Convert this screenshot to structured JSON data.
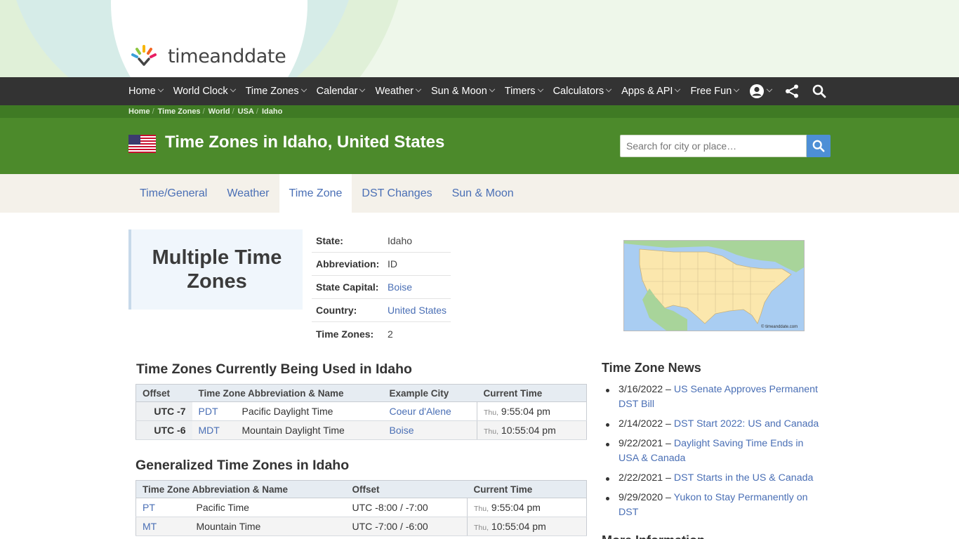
{
  "brand": {
    "name": "timeanddate"
  },
  "nav": {
    "items": [
      "Home",
      "World Clock",
      "Time Zones",
      "Calendar",
      "Weather",
      "Sun & Moon",
      "Timers",
      "Calculators",
      "Apps & API",
      "Free Fun"
    ]
  },
  "breadcrumb": [
    "Home",
    "Time Zones",
    "World",
    "USA",
    "Idaho"
  ],
  "header": {
    "title": "Time Zones in Idaho, United States",
    "search_placeholder": "Search for city or place…"
  },
  "tabs": [
    {
      "label": "Time/General",
      "active": false
    },
    {
      "label": "Weather",
      "active": false
    },
    {
      "label": "Time Zone",
      "active": true
    },
    {
      "label": "DST Changes",
      "active": false
    },
    {
      "label": "Sun & Moon",
      "active": false
    }
  ],
  "summary": {
    "headline": "Multiple Time Zones",
    "facts": [
      {
        "key": "State:",
        "value": "Idaho",
        "link": false
      },
      {
        "key": "Abbreviation:",
        "value": "ID",
        "link": false
      },
      {
        "key": "State Capital:",
        "value": "Boise",
        "link": true
      },
      {
        "key": "Country:",
        "value": "United States",
        "link": true
      },
      {
        "key": "Time Zones:",
        "value": "2",
        "link": false
      }
    ]
  },
  "map": {
    "credit": "© timeanddate.com"
  },
  "current_zones": {
    "title": "Time Zones Currently Being Used in Idaho",
    "headers": [
      "Offset",
      "Time Zone Abbreviation & Name",
      "Example City",
      "Current Time"
    ],
    "rows": [
      {
        "offset": "UTC -7",
        "abbr": "PDT",
        "name": "Pacific Daylight Time",
        "city": "Coeur d'Alene",
        "day": "Thu,",
        "time": "9:55:04 pm"
      },
      {
        "offset": "UTC -6",
        "abbr": "MDT",
        "name": "Mountain Daylight Time",
        "city": "Boise",
        "day": "Thu,",
        "time": "10:55:04 pm"
      }
    ]
  },
  "general_zones": {
    "title": "Generalized Time Zones in Idaho",
    "headers": [
      "Time Zone Abbreviation & Name",
      "Offset",
      "Current Time"
    ],
    "rows": [
      {
        "abbr": "PT",
        "name": "Pacific Time",
        "offset": "UTC -8:00 / -7:00",
        "day": "Thu,",
        "time": "9:55:04 pm"
      },
      {
        "abbr": "MT",
        "name": "Mountain Time",
        "offset": "UTC -7:00 / -6:00",
        "day": "Thu,",
        "time": "10:55:04 pm"
      }
    ]
  },
  "news": {
    "title": "Time Zone News",
    "items": [
      {
        "date": "3/16/2022 –",
        "link": "US Senate Approves Permanent DST Bill"
      },
      {
        "date": "2/14/2022 –",
        "link": "DST Start 2022: US and Canada"
      },
      {
        "date": "9/22/2021 –",
        "link": "Daylight Saving Time Ends in USA & Canada"
      },
      {
        "date": "2/22/2021 –",
        "link": "DST Starts in the US & Canada"
      },
      {
        "date": "9/29/2020 –",
        "link": "Yukon to Stay Permanently on DST"
      }
    ]
  },
  "more_info": {
    "title": "More Information"
  },
  "colors": {
    "nav_bg": "#333333",
    "header_green": "#4c8a2b",
    "link": "#4a6fb5",
    "search_button": "#4d8fd6"
  }
}
